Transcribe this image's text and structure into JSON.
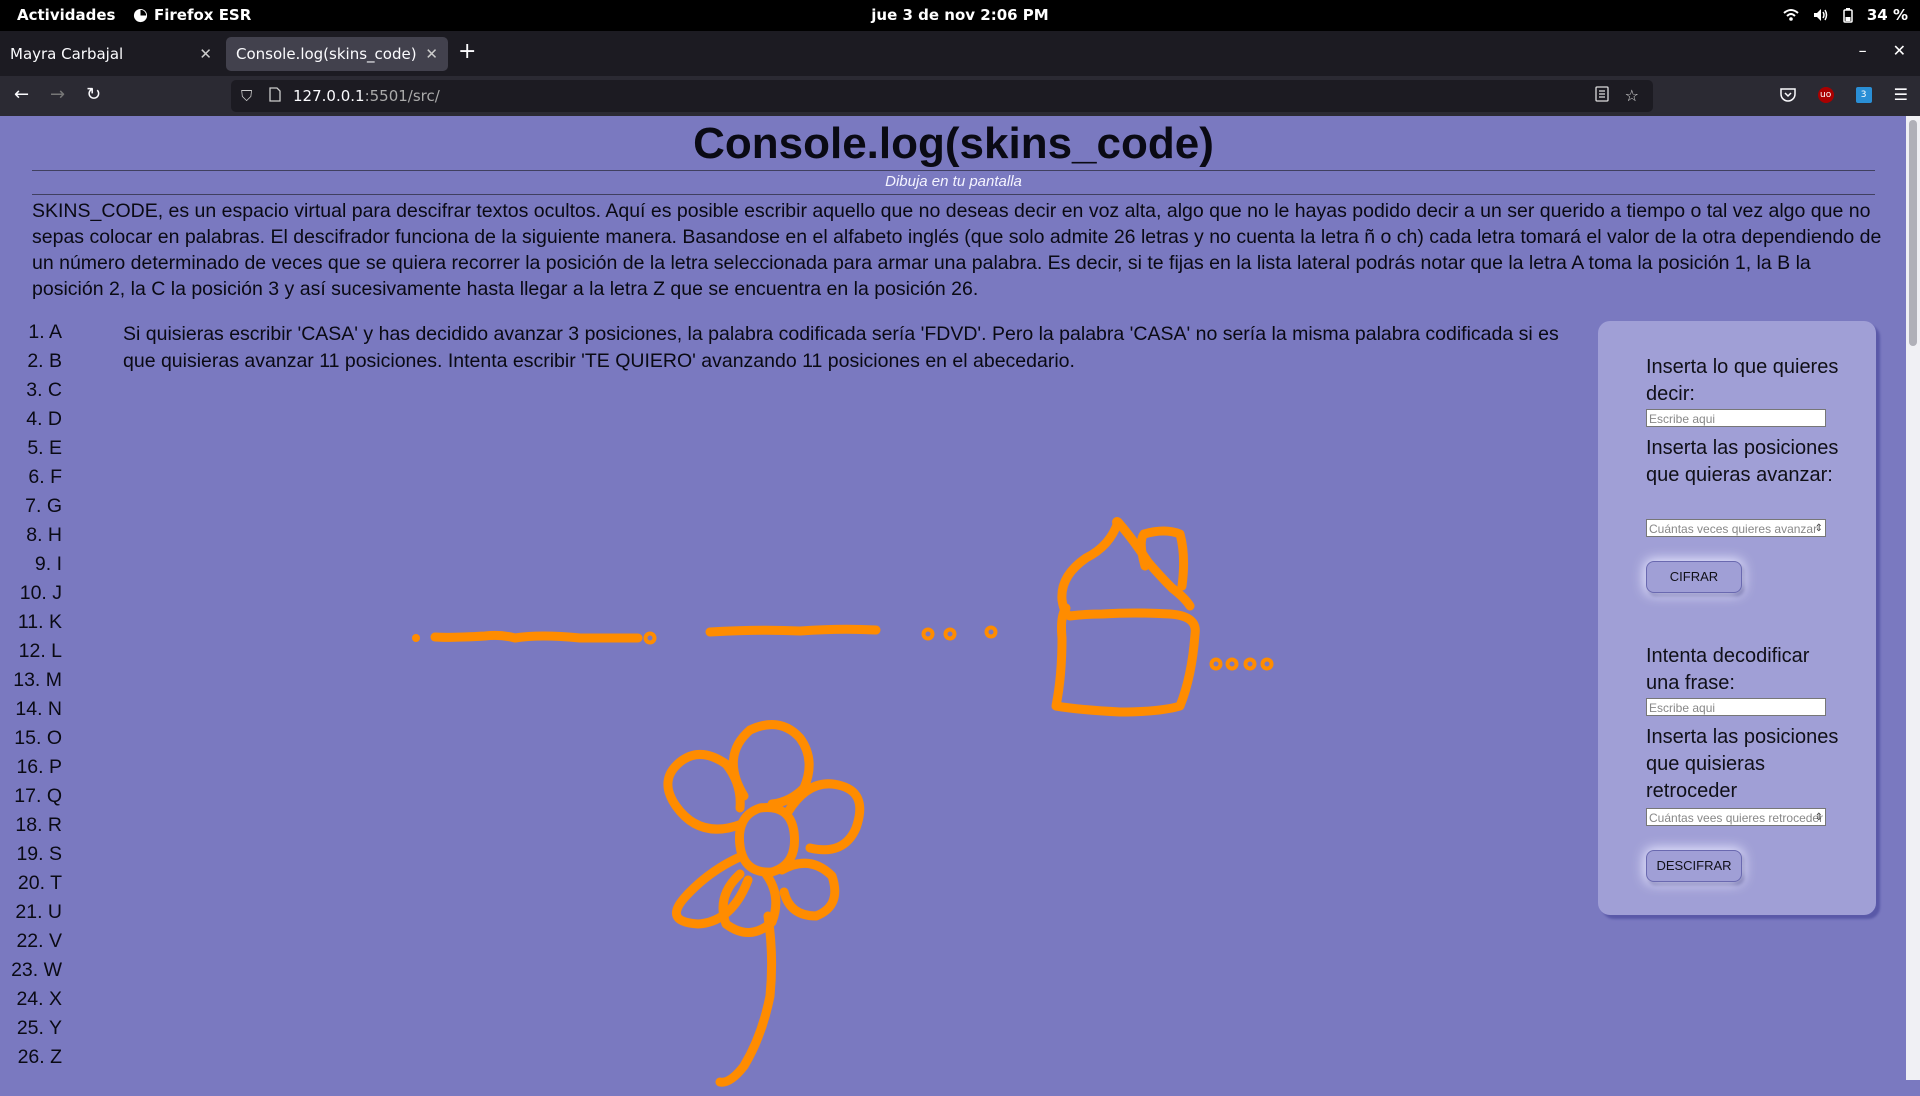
{
  "system_bar": {
    "activities": "Actividades",
    "app_name": "Firefox ESR",
    "clock": "jue  3 de nov  2:06 PM",
    "battery": "34 %",
    "icons": [
      "wifi-icon",
      "volume-icon",
      "battery-icon"
    ]
  },
  "browser": {
    "tabs": [
      {
        "label": "Mayra Carbajal",
        "active": false
      },
      {
        "label": "Console.log(skins_code)",
        "active": true
      }
    ],
    "new_tab": "+",
    "url_host": "127.0.0.1",
    "url_rest": ":5501/src/",
    "extension_badge": "3"
  },
  "page": {
    "title": "Console.log(skins_code)",
    "subtitle": "Dibuja en tu pantalla",
    "intro": "SKINS_CODE, es un espacio virtual para descifrar textos ocultos. Aquí es posible escribir aquello que no deseas decir en voz alta, algo que no le hayas podido decir a un ser querido a tiempo o tal vez algo que no sepas colocar en palabras. El descifrador funciona de la siguiente manera. Basandose en el alfabeto inglés (que solo admite 26 letras y no cuenta la letra ñ o ch) cada letra tomará el valor de la otra dependiendo de un número determinado de veces que se quiera recorrer la posición de la letra seleccionada para armar una palabra. Es decir, si te fijas en la lista lateral podrás notar que la letra A toma la posición 1, la B la posición 2, la C la posición 3 y así sucesivamente hasta llegar a la letra Z que se encuentra en la posición 26.",
    "example": "Si quisieras escribir 'CASA' y has decidido avanzar 3 posiciones, la palabra codificada sería 'FDVD'. Pero la palabra 'CASA' no sería la misma palabra codificada si es que quisieras avanzar 11 posiciones. Intenta escribir 'TE QUIERO' avanzando 11 posiciones en el abecedario.",
    "letters": [
      "1. A",
      "2. B",
      "3. C",
      "4. D",
      "5. E",
      "6. F",
      "7. G",
      "8. H",
      "9. I",
      "10. J",
      "11. K",
      "12. L",
      "13. M",
      "14. N",
      "15. O",
      "16. P",
      "17. Q",
      "18. R",
      "19. S",
      "20. T",
      "21. U",
      "22. V",
      "23. W",
      "24. X",
      "25. Y",
      "26. Z"
    ]
  },
  "panel": {
    "encode_label": "Inserta lo que quieres decir:",
    "encode_placeholder": "Escribe aqui",
    "encode_shift_label": "Inserta las posiciones que quieras avanzar:",
    "encode_shift_placeholder": "Cuántas veces quieres avanzar",
    "encode_button": "CIFRAR",
    "decode_label": "Intenta decodificar una frase:",
    "decode_placeholder": "Escribe aqui",
    "decode_shift_label": "Inserta las posiciones que quisieras retroceder",
    "decode_shift_placeholder": "Cuántas vees quieres retroceder",
    "decode_button": "DESCIFRAR"
  },
  "colors": {
    "page_background": "#7a79c0",
    "panel_background": "#a09fd6",
    "drawing_stroke": "#ff8c00"
  }
}
